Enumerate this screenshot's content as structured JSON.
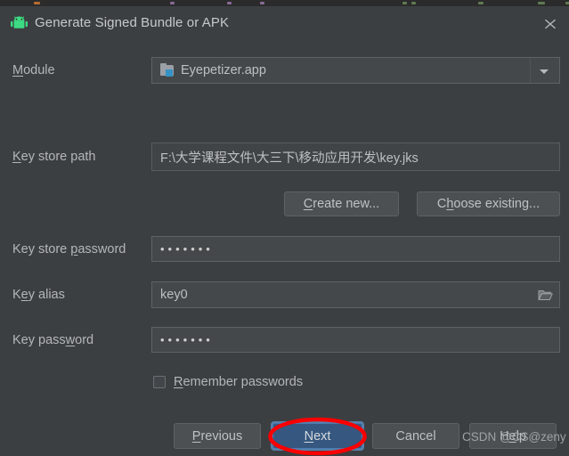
{
  "window": {
    "title": "Generate Signed Bundle or APK",
    "app_icon": "android-robot-icon",
    "close_icon": "close-icon",
    "background_color": "#3c3f41",
    "text_color": "#bbbbbb"
  },
  "fields": {
    "module": {
      "label_before": "M",
      "label_mnemonic": "M",
      "label": "Module",
      "label_rest": "odule",
      "value": "Eyepetizer.app",
      "icon": "module-folder-icon",
      "dropdown_icon": "chevron-down-icon"
    },
    "key_store_path": {
      "label": "Key store path",
      "label_mnemonic": "K",
      "label_rest": "ey store path",
      "value": "F:\\大学课程文件\\大三下\\移动应用开发\\key.jks"
    },
    "key_store_password": {
      "label": "Key store password",
      "label_pre": "Key store ",
      "label_mnemonic": "p",
      "label_rest": "assword",
      "value": "•••••••"
    },
    "key_alias": {
      "label": "Key alias",
      "label_pre": "K",
      "label_mnemonic": "e",
      "label_rest": "y alias",
      "value": "key0",
      "browse_icon": "folder-open-icon"
    },
    "key_password": {
      "label": "Key password",
      "label_pre": "Key pass",
      "label_mnemonic": "w",
      "label_rest": "ord",
      "value": "•••••••"
    },
    "remember_passwords": {
      "label": "Remember passwords",
      "label_mnemonic": "R",
      "label_rest": "emember passwords",
      "checked": false
    }
  },
  "buttons": {
    "create_new": {
      "label": "Create new...",
      "mnemonic": "C",
      "rest": "reate new..."
    },
    "choose_existing": {
      "label": "Choose existing...",
      "pre": "C",
      "mnemonic": "h",
      "rest": "oose existing..."
    },
    "previous": {
      "label": "Previous",
      "mnemonic": "P",
      "rest": "revious"
    },
    "next": {
      "label": "Next",
      "mnemonic": "N",
      "rest": "ext",
      "highlighted": true,
      "fill_color": "#365880"
    },
    "cancel": {
      "label": "Cancel"
    },
    "help": {
      "label": "Help",
      "pre": "H",
      "mnemonic": "e",
      "rest": "lp"
    }
  },
  "annotation": {
    "shape": "red-ellipse",
    "color": "#ff0000",
    "target": "next-button"
  },
  "watermark": {
    "text": "CSDN @CS@zeny"
  }
}
